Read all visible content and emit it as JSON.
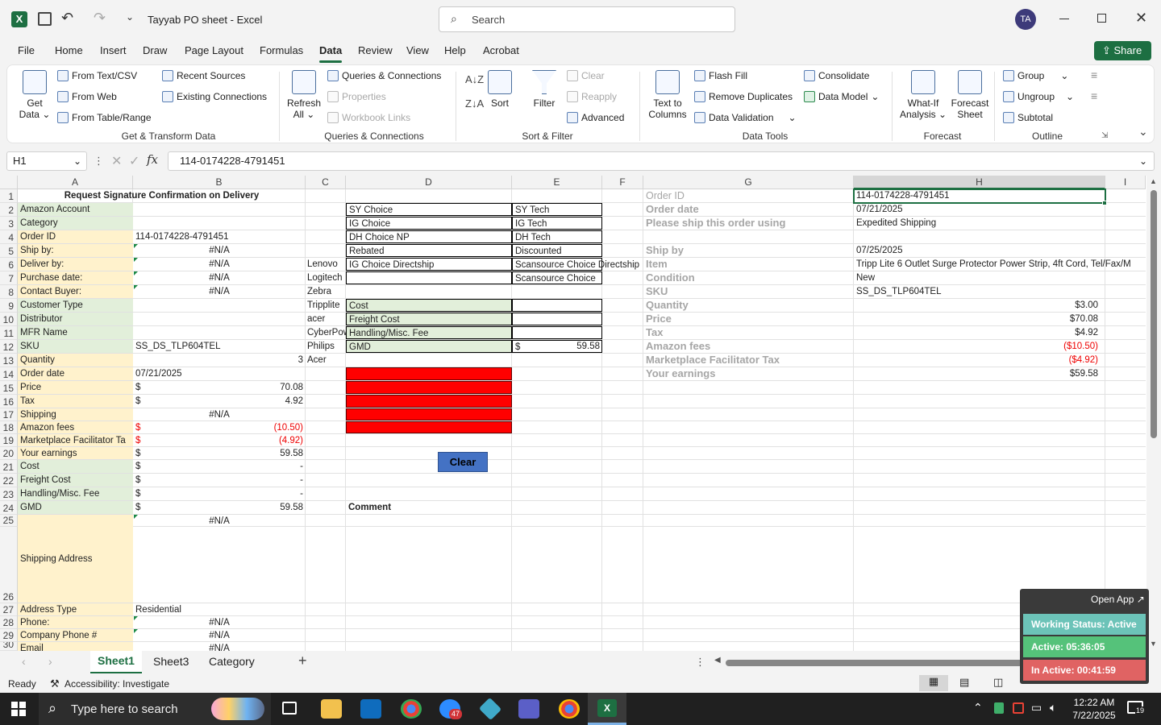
{
  "window": {
    "file_title": "Tayyab PO sheet",
    "app": "Excel",
    "search_placeholder": "Search",
    "avatar": "TA"
  },
  "menu": [
    "File",
    "Home",
    "Insert",
    "Draw",
    "Page Layout",
    "Formulas",
    "Data",
    "Review",
    "View",
    "Help",
    "Acrobat"
  ],
  "menu_active": "Data",
  "share_label": "Share",
  "ribbon": {
    "get_data": "Get",
    "get_data2": "Data",
    "from_text": "From Text/CSV",
    "from_web": "From Web",
    "from_table": "From Table/Range",
    "recent_sources": "Recent Sources",
    "existing_connections": "Existing Connections",
    "group_get": "Get & Transform Data",
    "refresh": "Refresh",
    "refresh2": "All",
    "queries": "Queries & Connections",
    "properties": "Properties",
    "workbook_links": "Workbook Links",
    "group_queries": "Queries & Connections",
    "sort": "Sort",
    "filter": "Filter",
    "clear": "Clear",
    "reapply": "Reapply",
    "advanced": "Advanced",
    "group_sort": "Sort & Filter",
    "text_to_columns": "Text to",
    "text_to_columns2": "Columns",
    "flash_fill": "Flash Fill",
    "remove_duplicates": "Remove Duplicates",
    "data_validation": "Data Validation",
    "consolidate": "Consolidate",
    "data_model": "Data Model",
    "group_tools": "Data Tools",
    "what_if": "What-If",
    "what_if2": "Analysis",
    "forecast_sheet": "Forecast",
    "forecast_sheet2": "Sheet",
    "group_forecast": "Forecast",
    "group_btn": "Group",
    "ungroup": "Ungroup",
    "subtotal": "Subtotal",
    "group_outline": "Outline"
  },
  "formula_bar": {
    "name_box": "H1",
    "fx": "fx",
    "value": "114-0174228-4791451"
  },
  "columns": [
    "A",
    "B",
    "C",
    "D",
    "E",
    "F",
    "G",
    "H",
    "I"
  ],
  "rows": [
    "1",
    "2",
    "3",
    "4",
    "5",
    "6",
    "7",
    "8",
    "9",
    "10",
    "11",
    "12",
    "13",
    "14",
    "15",
    "16",
    "17",
    "18",
    "19",
    "20",
    "21",
    "22",
    "23",
    "24",
    "25",
    "26",
    "27",
    "28",
    "29",
    "30"
  ],
  "sheet": {
    "title": "Request Signature Confirmation on Delivery",
    "a": [
      "Amazon Account",
      "Category",
      "Order ID",
      "Ship by:",
      "Deliver by:",
      "Purchase date:",
      "Contact Buyer:",
      "Customer Type",
      "Distributor",
      "MFR Name",
      "SKU",
      "Quantity",
      "Order date",
      "Price",
      "Tax",
      "Shipping",
      "Amazon fees",
      "Marketplace Facilitator Ta",
      "Your earnings",
      "Cost",
      "Freight Cost",
      "Handling/Misc. Fee",
      "GMD",
      "Contact Buyer:",
      "Shipping Address",
      "Address Type",
      "Phone:",
      "Company Phone #",
      "Email"
    ],
    "b": {
      "order_id": "114-0174228-4791451",
      "ship_by": "#N/A",
      "deliver_by": "#N/A",
      "purchase": "#N/A",
      "contact": "#N/A",
      "sku": "SS_DS_TLP604TEL",
      "qty": "3",
      "order_date": "07/21/2025",
      "dollar": "$",
      "price": "70.08",
      "tax": "4.92",
      "shipping": "#N/A",
      "fees": "(10.50)",
      "mft": "(4.92)",
      "earnings": "59.58",
      "cost": "-",
      "freight": "-",
      "handling": "-",
      "gmd": "59.58",
      "contact2": "#N/A",
      "addr_type": "Residential",
      "phone": "#N/A",
      "cphone": "#N/A",
      "email": "#N/A"
    },
    "c": [
      "Lenovo",
      "Logitech",
      "Zebra",
      "Tripplite",
      "acer",
      "CyberPow",
      "Philips",
      "Acer"
    ],
    "d_choices": [
      "SY Choice",
      "IG Choice",
      "DH Choice NP",
      "Rebated",
      "IG Choice Directship"
    ],
    "e_choices": [
      "SY Tech",
      "IG Tech",
      "DH Tech",
      "Discounted",
      "Scansource Choice Directship",
      "Scansource Choice"
    ],
    "d_costs": [
      "Cost",
      "Freight Cost",
      "Handling/Misc. Fee",
      "GMD"
    ],
    "e_gmd_dollar": "$",
    "e_gmd": "59.58",
    "clear_btn": "Clear",
    "comment": "Comment",
    "g": [
      "Order ID",
      "Order date",
      "Please ship this order using",
      "Ship by",
      "Item",
      "Condition",
      "SKU",
      "Quantity",
      "Price",
      "Tax",
      "Amazon fees",
      "Marketplace Facilitator Tax",
      "Your earnings"
    ],
    "h": {
      "order_id": "114-0174228-4791451",
      "order_date": "07/21/2025",
      "shipping": "Expedited Shipping",
      "ship_by": "07/25/2025",
      "item": "Tripp Lite 6 Outlet Surge Protector Power Strip, 4ft Cord, Tel/Fax/M",
      "condition": "New",
      "sku": "SS_DS_TLP604TEL",
      "qty": "$3.00",
      "price": "$70.08",
      "tax": "$4.92",
      "fees": "($10.50)",
      "mft": "($4.92)",
      "earnings": "$59.58"
    }
  },
  "sheets": [
    "Sheet1",
    "Sheet3",
    "Category"
  ],
  "active_sheet": "Sheet1",
  "status": {
    "ready": "Ready",
    "accessibility": "Accessibility: Investigate"
  },
  "widget": {
    "open_app": "Open App",
    "working": "Working Status: Active",
    "active": "Active: 05:36:05",
    "inactive": "In Active: 00:41:59"
  },
  "taskbar": {
    "search": "Type here to search",
    "time": "12:22 AM",
    "date": "7/22/2025",
    "zoom_badge": "47",
    "notif": "19"
  }
}
